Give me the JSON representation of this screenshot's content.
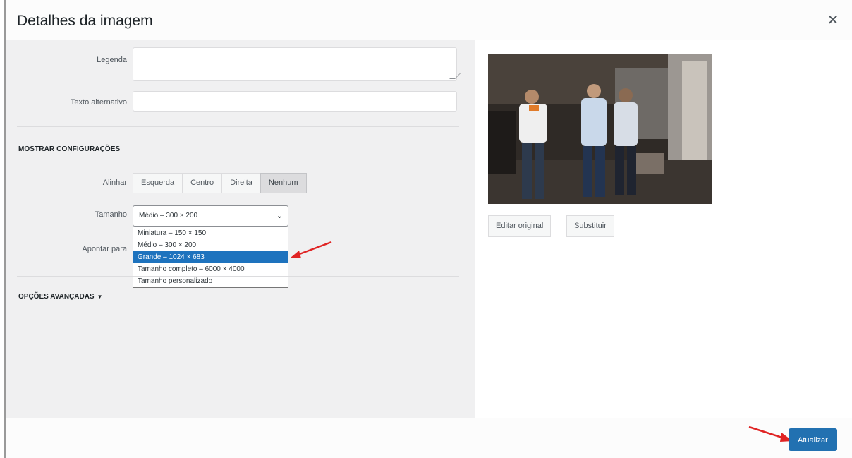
{
  "dialog": {
    "title": "Detalhes da imagem",
    "close_icon": "close-icon"
  },
  "fields": {
    "caption_label": "Legenda",
    "caption_value": "",
    "alt_label": "Texto alternativo",
    "alt_value": ""
  },
  "display_settings": {
    "heading": "MOSTRAR CONFIGURAÇÕES",
    "align_label": "Alinhar",
    "align_options": [
      "Esquerda",
      "Centro",
      "Direita",
      "Nenhum"
    ],
    "align_selected": "Nenhum",
    "size_label": "Tamanho",
    "size_selected": "Médio – 300 × 200",
    "size_options": [
      "Miniatura – 150 × 150",
      "Médio – 300 × 200",
      "Grande – 1024 × 683",
      "Tamanho completo – 6000 × 4000",
      "Tamanho personalizado"
    ],
    "size_highlighted": "Grande – 1024 × 683",
    "link_label": "Apontar para"
  },
  "advanced": {
    "label": "OPÇÕES AVANÇADAS",
    "toggle_icon": "triangle-down-icon"
  },
  "preview": {
    "edit_label": "Editar original",
    "replace_label": "Substituir"
  },
  "footer": {
    "update_label": "Atualizar"
  },
  "colors": {
    "primary": "#2271b1",
    "selection": "#1e73be",
    "annotation_arrow": "#e02424"
  }
}
